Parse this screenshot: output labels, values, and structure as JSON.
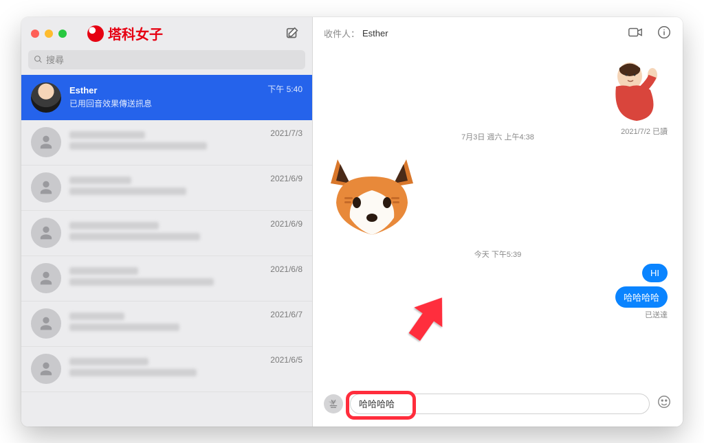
{
  "branding": {
    "name": "塔科女子"
  },
  "search": {
    "placeholder": "搜尋"
  },
  "sidebar": {
    "conversations": [
      {
        "name": "Esther",
        "preview": "已用回音效果傳送訊息",
        "time": "下午 5:40"
      },
      {
        "time": "2021/7/3"
      },
      {
        "time": "2021/6/9"
      },
      {
        "time": "2021/6/9"
      },
      {
        "time": "2021/6/8"
      },
      {
        "time": "2021/6/7"
      },
      {
        "time": "2021/6/5"
      }
    ]
  },
  "header": {
    "to_label": "收件人：",
    "to_value": "Esther"
  },
  "thread": {
    "read_ts": "2021/7/2 已讀",
    "sep1": "7月3日 週六 上午4:38",
    "sep2": "今天 下午5:39",
    "messages": [
      {
        "text": "HI"
      },
      {
        "text": "哈哈哈哈"
      }
    ],
    "delivered": "已送達"
  },
  "composer": {
    "value": "哈哈哈哈"
  }
}
